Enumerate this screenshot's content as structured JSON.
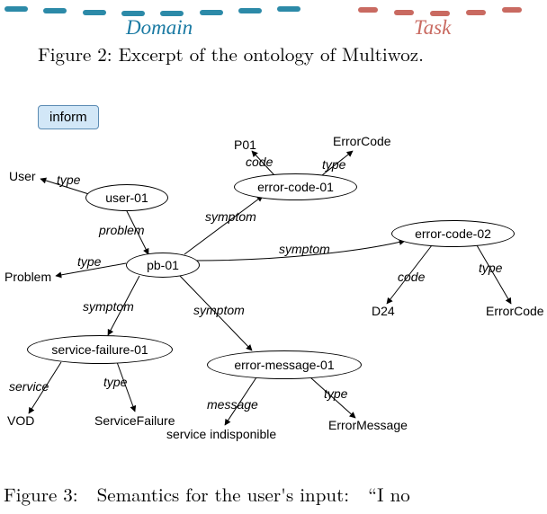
{
  "header": {
    "domain_label": "Domain",
    "task_label": "Task"
  },
  "captions": {
    "fig2": "Figure 2: Excerpt of the ontology of Multiwoz.",
    "fig3_line1": "Figure 3:  Semantics for the user's input:  “I no"
  },
  "tag": {
    "inform": "inform"
  },
  "chart_data": {
    "type": "graph",
    "title": "Semantics for the user's input",
    "nodes": [
      {
        "id": "user-01",
        "label": "user-01",
        "kind": "instance"
      },
      {
        "id": "pb-01",
        "label": "pb-01",
        "kind": "instance"
      },
      {
        "id": "error-code-01",
        "label": "error-code-01",
        "kind": "instance"
      },
      {
        "id": "error-code-02",
        "label": "error-code-02",
        "kind": "instance"
      },
      {
        "id": "service-failure-01",
        "label": "service-failure-01",
        "kind": "instance"
      },
      {
        "id": "error-message-01",
        "label": "error-message-01",
        "kind": "instance"
      },
      {
        "id": "User",
        "label": "User",
        "kind": "class"
      },
      {
        "id": "Problem",
        "label": "Problem",
        "kind": "class"
      },
      {
        "id": "P01",
        "label": "P01",
        "kind": "literal"
      },
      {
        "id": "ErrorCode1",
        "label": "ErrorCode",
        "kind": "class"
      },
      {
        "id": "ErrorCode2",
        "label": "ErrorCode",
        "kind": "class"
      },
      {
        "id": "D24",
        "label": "D24",
        "kind": "literal"
      },
      {
        "id": "VOD",
        "label": "VOD",
        "kind": "literal"
      },
      {
        "id": "ServiceFailure",
        "label": "ServiceFailure",
        "kind": "class"
      },
      {
        "id": "service_indisponible",
        "label": "service indisponible",
        "kind": "literal"
      },
      {
        "id": "ErrorMessage",
        "label": "ErrorMessage",
        "kind": "class"
      }
    ],
    "edges": [
      {
        "from": "user-01",
        "to": "User",
        "label": "type"
      },
      {
        "from": "user-01",
        "to": "pb-01",
        "label": "problem"
      },
      {
        "from": "pb-01",
        "to": "Problem",
        "label": "type"
      },
      {
        "from": "pb-01",
        "to": "error-code-01",
        "label": "symptom"
      },
      {
        "from": "pb-01",
        "to": "error-code-02",
        "label": "symptom"
      },
      {
        "from": "pb-01",
        "to": "service-failure-01",
        "label": "symptom"
      },
      {
        "from": "pb-01",
        "to": "error-message-01",
        "label": "symptom"
      },
      {
        "from": "error-code-01",
        "to": "P01",
        "label": "code"
      },
      {
        "from": "error-code-01",
        "to": "ErrorCode1",
        "label": "type"
      },
      {
        "from": "error-code-02",
        "to": "D24",
        "label": "code"
      },
      {
        "from": "error-code-02",
        "to": "ErrorCode2",
        "label": "type"
      },
      {
        "from": "service-failure-01",
        "to": "VOD",
        "label": "service"
      },
      {
        "from": "service-failure-01",
        "to": "ServiceFailure",
        "label": "type"
      },
      {
        "from": "error-message-01",
        "to": "service_indisponible",
        "label": "message"
      },
      {
        "from": "error-message-01",
        "to": "ErrorMessage",
        "label": "type"
      }
    ]
  },
  "nodes_text": {
    "user01": "user-01",
    "pb01": "pb-01",
    "errorcode01": "error-code-01",
    "errorcode02": "error-code-02",
    "servicefailure01": "service-failure-01",
    "errormessage01": "error-message-01"
  },
  "terminals": {
    "User": "User",
    "Problem": "Problem",
    "P01": "P01",
    "ErrorCode": "ErrorCode",
    "D24": "D24",
    "VOD": "VOD",
    "ServiceFailure": "ServiceFailure",
    "service_indisponible": "service indisponible",
    "ErrorMessage": "ErrorMessage"
  },
  "edge_labels": {
    "type": "type",
    "problem": "problem",
    "symptom": "symptom",
    "code": "code",
    "service": "service",
    "message": "message"
  }
}
